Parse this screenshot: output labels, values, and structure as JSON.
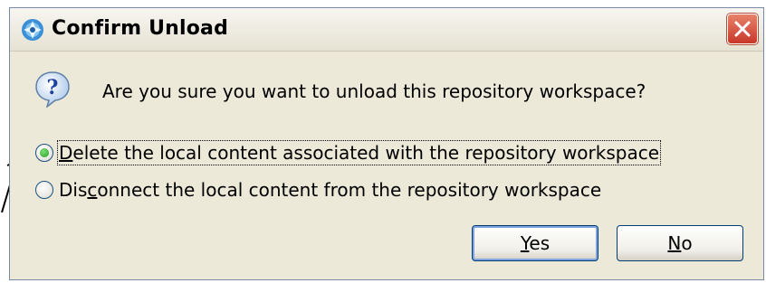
{
  "window": {
    "title": "Confirm Unload",
    "close_icon": "close-icon"
  },
  "message": {
    "icon": "question-icon",
    "text": "Are you sure you want to unload this repository workspace?"
  },
  "options": [
    {
      "accel": "D",
      "rest": "elete the local content associated with the repository workspace",
      "checked": true
    },
    {
      "pre": "Dis",
      "accel": "c",
      "rest": "onnect the local content from the repository workspace",
      "checked": false
    }
  ],
  "buttons": {
    "yes": {
      "accel": "Y",
      "rest": "es"
    },
    "no": {
      "accel": "N",
      "rest": "o"
    }
  },
  "colors": {
    "dialog_bg": "#ece9d8",
    "close_button": "#c8382a",
    "radio_checked": "#1f9c1a"
  }
}
